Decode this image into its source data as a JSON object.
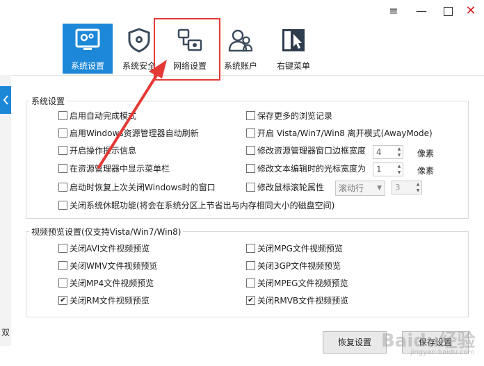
{
  "window": {
    "menu_glyph": "≡",
    "min_glyph": "—",
    "close_glyph": "✕"
  },
  "toolbar": {
    "items": [
      {
        "label": "系统设置",
        "icon": "monitor-gear-icon",
        "active": true
      },
      {
        "label": "系统安全",
        "icon": "shield-gear-icon",
        "active": false
      },
      {
        "label": "网络设置",
        "icon": "network-gear-icon",
        "active": false
      },
      {
        "label": "系统账户",
        "icon": "users-icon",
        "active": false
      },
      {
        "label": "右键菜单",
        "icon": "cursor-menu-icon",
        "active": false
      }
    ],
    "accent_color": "#1e88d8",
    "highlight_color": "#e53935"
  },
  "left_panel": {
    "partial_text": "双"
  },
  "system_settings": {
    "title": "系统设置",
    "options": {
      "auto_complete": {
        "label": "启用自动完成模式",
        "checked": false
      },
      "save_history": {
        "label": "保存更多的浏览记录",
        "checked": false
      },
      "explorer_refresh": {
        "label": "启用Windows资源管理器自动刷新",
        "checked": false
      },
      "away_mode": {
        "label": "开启 Vista/Win7/Win8 离开模式(AwayMode)",
        "checked": false
      },
      "tooltip_info": {
        "label": "开启操作提示信息",
        "checked": false
      },
      "border_width": {
        "label": "修改资源管理器窗口边框宽度",
        "checked": false,
        "value": "4",
        "unit": "像素"
      },
      "show_menubar": {
        "label": "在资源管理器中显示菜单栏",
        "checked": false
      },
      "cursor_width": {
        "label": "修改文本编辑时的光标宽度为",
        "checked": false,
        "value": "1",
        "unit": "像素"
      },
      "restore_windows": {
        "label": "启动时恢复上次关闭Windows时的窗口",
        "checked": false
      },
      "wheel_attr": {
        "label": "修改鼠标滚轮属性",
        "checked": false,
        "select_value": "滚动行",
        "value": "3"
      },
      "disable_hibernate": {
        "label": "关闭系统休眠功能(将会在系统分区上节省出与内存相同大小的磁盘空间)",
        "checked": false
      }
    }
  },
  "video_settings": {
    "title": "视频预览设置(仅支持Vista/Win7/Win8)",
    "options": {
      "avi": {
        "label": "关闭AVI文件视频预览",
        "checked": false
      },
      "mpg": {
        "label": "关闭MPG文件视频预览",
        "checked": false
      },
      "wmv": {
        "label": "关闭WMV文件视频预览",
        "checked": false
      },
      "gp3": {
        "label": "关闭3GP文件视频预览",
        "checked": false
      },
      "mp4": {
        "label": "关闭MP4文件视频预览",
        "checked": false
      },
      "mpeg": {
        "label": "关闭MPEG文件视频预览",
        "checked": false
      },
      "rm": {
        "label": "关闭RM文件视频预览",
        "checked": true
      },
      "rmvb": {
        "label": "关闭RMVB文件视频预览",
        "checked": true
      }
    }
  },
  "buttons": {
    "restore": "恢复设置",
    "save": "保存设置"
  },
  "watermark": {
    "text": "Baidu经验",
    "sub": "jingyan.baidu.com"
  }
}
